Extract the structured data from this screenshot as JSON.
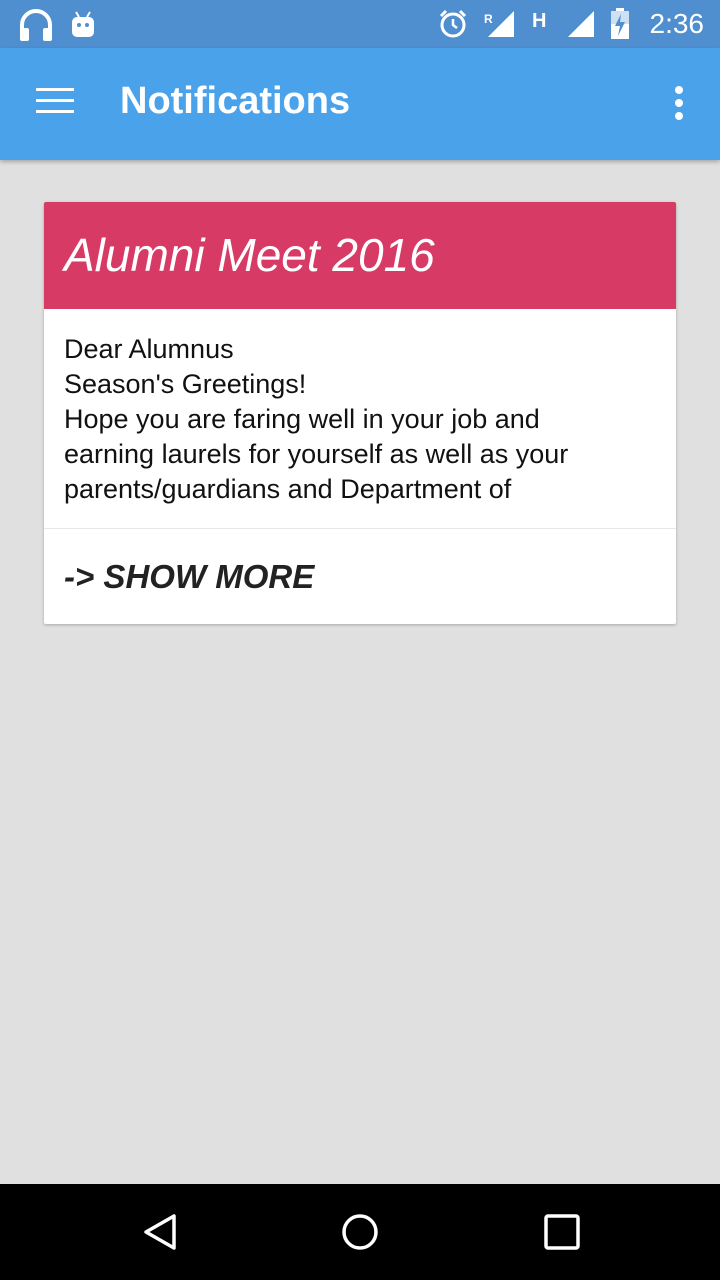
{
  "status_bar": {
    "time": "2:36",
    "left_icons": [
      "headphones-icon",
      "android-icon"
    ],
    "right_icons": [
      "alarm-icon",
      "signal-r-icon",
      "h-network-icon",
      "signal-icon",
      "battery-charging-icon"
    ],
    "roaming_label": "R",
    "network_label": "H"
  },
  "app_bar": {
    "title": "Notifications",
    "background": "#4aa3ea"
  },
  "notification": {
    "title": "Alumni Meet 2016",
    "header_color": "#d63a65",
    "body_lines": [
      "Dear Alumnus",
      "Season's Greetings!",
      "Hope you are faring well in your job and",
      "earning laurels for yourself as well as your",
      "parents/guardians and Department of"
    ],
    "show_more_label": "-> SHOW MORE"
  },
  "nav_bar": {
    "buttons": [
      "back-icon",
      "home-icon",
      "recents-icon"
    ]
  }
}
